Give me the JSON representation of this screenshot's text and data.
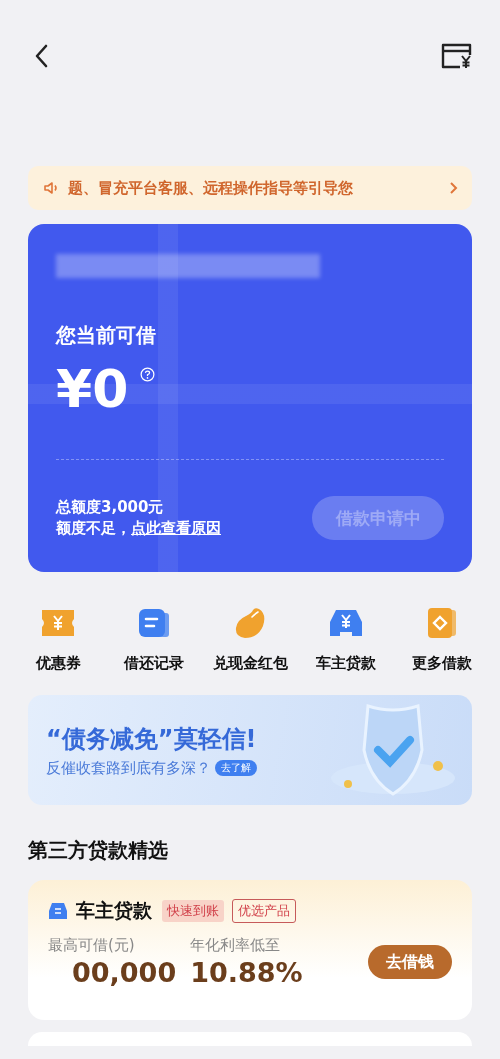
{
  "notice": {
    "text": "题、冒充平台客服、远程操作指导等引导您"
  },
  "credit_card": {
    "title": "您当前可借",
    "amount": "¥0",
    "total": "总额度3,000元",
    "hint": "额度不足，",
    "reason_link": "点此查看原因",
    "button": {
      "label": "借款申请中",
      "disabled": true
    }
  },
  "shortcuts": [
    {
      "label": "优惠券",
      "kind": "coupon",
      "color": "#f0a22e"
    },
    {
      "label": "借还记录",
      "kind": "record",
      "color": "#3f7ff0"
    },
    {
      "label": "兑现金红包",
      "kind": "bean",
      "color": "#f0a22e"
    },
    {
      "label": "车主贷款",
      "kind": "car",
      "color": "#3f7ff0"
    },
    {
      "label": "更多借款",
      "kind": "more",
      "color": "#f0a22e"
    }
  ],
  "banner": {
    "headline": "“债务减免”莫轻信!",
    "subline": "反催收套路到底有多深？",
    "link": "去了解"
  },
  "section_title": "第三方贷款精选",
  "products": [
    {
      "name": "车主贷款",
      "tags": [
        {
          "label": "快速到账",
          "kind": "filled"
        },
        {
          "label": "优选产品",
          "kind": "outline"
        }
      ],
      "limit_label": "最高可借(元)",
      "limit": "00,000",
      "rate_label": "年化利率低至",
      "rate": "10.88%",
      "button": "去借钱"
    }
  ]
}
